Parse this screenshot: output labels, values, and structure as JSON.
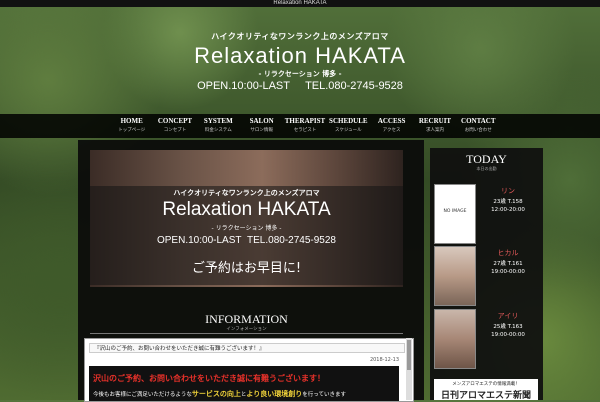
{
  "top_strip": {
    "title": "Relaxation HAKATA"
  },
  "header": {
    "tagline": "ハイクオリティなワンランク上のメンズアロマ",
    "logo": "Relaxation HAKATA",
    "logo_sub": "- リラクセーション 博多 -",
    "open": "OPEN.10:00-LAST",
    "tel": "TEL.080-2745-9528"
  },
  "nav": [
    {
      "en": "HOME",
      "jp": "トップページ"
    },
    {
      "en": "CONCEPT",
      "jp": "コンセプト"
    },
    {
      "en": "SYSTEM",
      "jp": "料金システム"
    },
    {
      "en": "SALON",
      "jp": "サロン情報"
    },
    {
      "en": "THERAPIST",
      "jp": "セラピスト"
    },
    {
      "en": "SCHEDULE",
      "jp": "スケジュール"
    },
    {
      "en": "ACCESS",
      "jp": "アクセス"
    },
    {
      "en": "RECRUIT",
      "jp": "求人案内"
    },
    {
      "en": "CONTACT",
      "jp": "お問い合わせ"
    }
  ],
  "hero": {
    "tagline": "ハイクオリティなワンランク上のメンズアロマ",
    "logo": "Relaxation HAKATA",
    "logo_sub": "- リラクセーション 博多 -",
    "open": "OPEN.10:00-LAST",
    "tel": "TEL.080-2745-9528",
    "cta": "ご予約はお早目に!"
  },
  "information": {
    "title": "INFORMATION",
    "subtitle": "インフォメーション",
    "item_title": "『沢山のご予約、お問い合わせをいただき誠に有難うございます！』",
    "date": "2018-12-13",
    "banner_red": "沢山のご予約、お問い合わせをいただき誠に有難うございます！",
    "banner_text_1": "今後もお客様にご満足いただけるような",
    "banner_highlight_1": "サービスの向上",
    "banner_text_2": "と",
    "banner_highlight_2": "より良い環境創り",
    "banner_text_3": "を行っていきます"
  },
  "today": {
    "title": "TODAY",
    "subtitle": "本日の出勤",
    "cards": [
      {
        "name": "リン",
        "meta": "23歳 T.158",
        "time": "12:00-20:00",
        "photo": "NO IMAGE"
      },
      {
        "name": "ヒカル",
        "meta": "27歳 T.161",
        "time": "19:00-00:00",
        "photo": ""
      },
      {
        "name": "アイリ",
        "meta": "25歳 T.163",
        "time": "19:00-00:00",
        "photo": ""
      }
    ]
  },
  "ad": {
    "line1": "メンズアロマエステの情報満載！",
    "line2": "日刊アロマエステ新聞"
  }
}
